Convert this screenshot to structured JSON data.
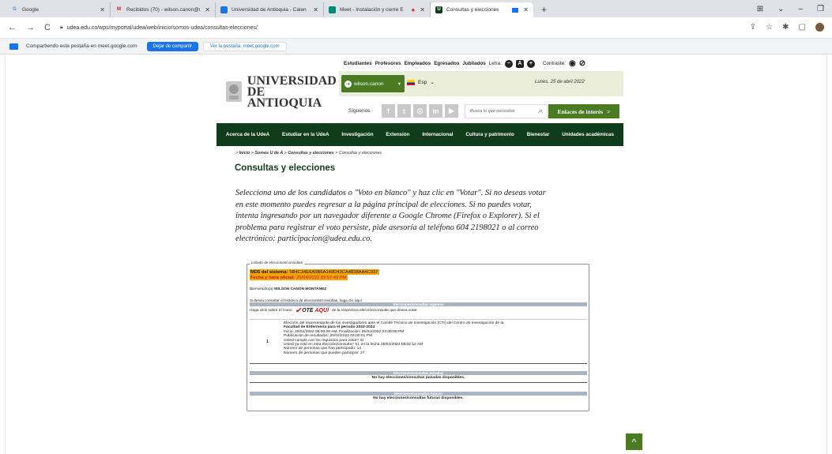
{
  "browser": {
    "tabs": [
      {
        "title": "Google",
        "icon": "google-icon",
        "color": "#ffffff",
        "glyph": "G"
      },
      {
        "title": "Recibidos (70) - wilson.canon@u",
        "icon": "gmail-icon",
        "color": "#c5221f",
        "glyph": "M"
      },
      {
        "title": "Universidad de Antioquia - Calen",
        "icon": "calendar-icon",
        "color": "#1a73e8",
        "glyph": ""
      },
      {
        "title": "Meet - Instalación y cierre E",
        "icon": "meet-icon",
        "color": "#00897b",
        "glyph": ""
      },
      {
        "title": "Consultas y elecciones",
        "icon": "udea-icon",
        "color": "#0f3c1a",
        "glyph": "U"
      }
    ],
    "url": "udea.edu.co/wps/myportal/udea/web/inicio/somos-udea/consultas-elecciones/",
    "share_notice": "Compartiendo esta pestaña en meet.google.com",
    "stop_sharing": "Dejar de compartir",
    "view_tab": "Ver la pestaña: meet.google.com"
  },
  "header": {
    "top_links": [
      "Estudiantes",
      "Profesores",
      "Empleados",
      "Egresados",
      "Jubilados"
    ],
    "letra_label": "Letra:",
    "contraste_label": "Contraste:",
    "logo_line1": "UNIVERSIDAD",
    "logo_line2": "DE ANTIOQUIA",
    "user_name": "wilson.canon",
    "language": "Esp",
    "date": "Lunes, 25 de abril 2022",
    "follow_label": "Síguenos",
    "search_placeholder": "Busca lo que necesitas",
    "enlaces": "Enlaces de interés",
    "colors": {
      "green": "#4a7a22",
      "dark_green": "#0f3c1a",
      "orange": "#f7a400"
    }
  },
  "nav": [
    "Acerca de la UdeA",
    "Estudiar en la UdeA",
    "Investigación",
    "Extensión",
    "Internacional",
    "Cultura y patrimonio",
    "Bienestar",
    "Unidades académicas"
  ],
  "breadcrumb": {
    "inicio": "Inicio",
    "somos": "Somos U de A",
    "consultas": "Consultas y elecciones",
    "current": "Consultas y elecciones"
  },
  "content": {
    "title": "Consultas y elecciones",
    "intro_lines": [
      "Selecciona uno de los candidatos o \"Voto en blanco\" y haz clic en \"Votar\". Si no deseas votar",
      "en este momento puedes regresar a la página principal de elecciones. Si no puedes votar,",
      "intenta ingresando por un navegador diferente a Google Chrome (Firefox o Explorer). Si el",
      "problema para registrar el voto persiste, pide asesoría al teléfono 604 2198021 o al correo",
      "electrónico: participacion@udea.edu.co."
    ]
  },
  "elections": {
    "legend": "Listado de elecciones/consultas",
    "md5_label": "MD5 del sistema:",
    "md5_value": "5B4C34E6A5B6A149D43CA4838AA4C937",
    "fecha_label": "Fecha y hora oficial:",
    "fecha_value": "25/04/2022 03:57:49 PM",
    "bienvenido_prefix": "Bienvenido(a)",
    "bienvenido_name": "WILSON CANON MONTANEZ",
    "historico": "Si desea consultar el histórico de elecciones/consultas, haga clic aquí",
    "vigentes_header": "Elecciones/consultas vigentes",
    "click_before": "Haga click sobre el ícono",
    "vote_word1": "OTE",
    "vote_word2": "AQUÍ",
    "click_after": "de la respectiva elección/consulta que desea votar.",
    "item_number": "1",
    "item_lines": [
      "Elección del representante de los investigadores ante el Comité Técnico de Investigación (CTI) del Centro de Investigación de la",
      "Facultad de Enfermería para el periodo 2022-2024",
      "Inicio: 25/04/2022 08:00:00 AM, Finalización: 25/04/2022 04:00:00 PM",
      "Publicación de resultados: 25/04/2022 04:00:01 PM",
      "Usted cumple con los requisitos para votar? SI",
      "Usted ya votó en esta elección/consulta? SI, en la fecha 25/04/2022 08:02:12 AM",
      "Número de personas que han participado: 14",
      "Número de personas que pueden participar: 27"
    ],
    "pasadas_header": "Elecciones/consultas pasadas",
    "pasadas_empty": "No hay elecciones/consultas pasadas disponibles.",
    "futuras_header": "Elecciones/consultas futuras",
    "futuras_empty": "No hay elecciones/consultas futuras disponibles."
  }
}
